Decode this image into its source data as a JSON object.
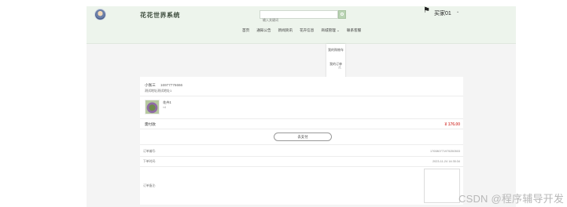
{
  "header": {
    "site_title": "花花世界系统",
    "search_placeholder": "输入关键词",
    "user_name": "买家01",
    "user_caret": "⌄"
  },
  "nav": {
    "items": [
      "首页",
      "通知公告",
      "新闻资讯",
      "花卉信息",
      "商城管理 ⌄",
      "联系客服"
    ]
  },
  "dropdown": {
    "items": [
      "我的购物车",
      "我的订单",
      "我的地址"
    ]
  },
  "order": {
    "receiver_name": "小张三",
    "receiver_phone": "16977776666",
    "receiver_address": "测试地址测试地址1",
    "goods_name": "花卉1",
    "goods_qty": "×4",
    "paid_label": "需付款",
    "paid_amount": "¥ 176.00",
    "pay_button": "去支付",
    "order_no_label": "订单编号:",
    "order_no_value": "170080771975250503",
    "order_time_label": "下单时间:",
    "order_time_value": "2023-11-24 14:35:34",
    "remark_label": "订单备注:"
  },
  "watermark": "CSDN @程序辅导开发",
  "colors": {
    "header_bg": "#edf4ec",
    "price": "#d9534f",
    "accent_green": "#b9d3b3"
  },
  "icons": {
    "user": "user-card-icon",
    "search": "search-icon",
    "cursor": "pointer-hand-icon"
  }
}
